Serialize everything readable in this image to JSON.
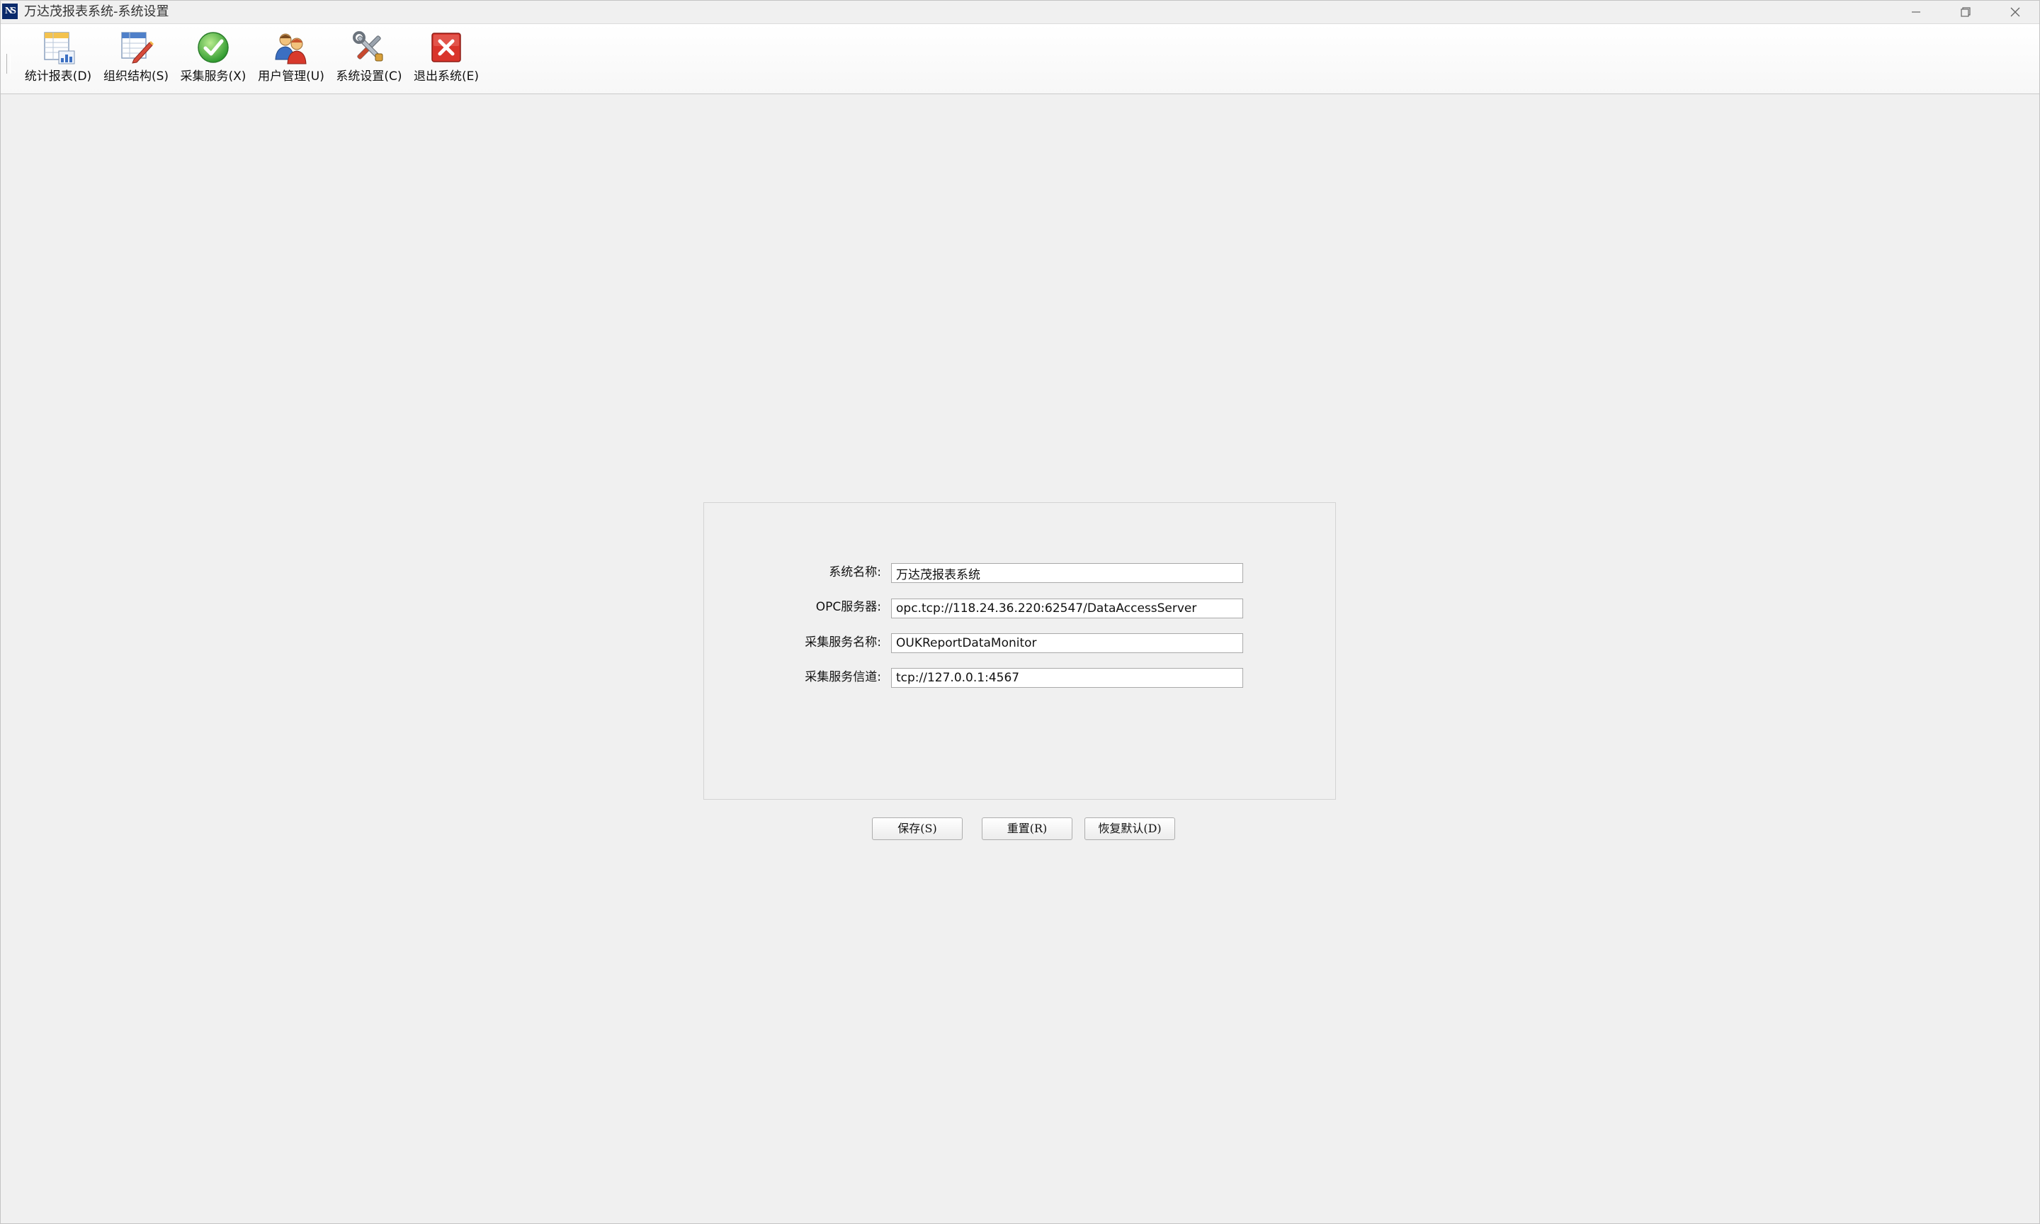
{
  "window": {
    "title": "万达茂报表系统-系统设置",
    "logo_text": "NS",
    "minimize_icon": "minimize-icon",
    "restore_icon": "restore-icon",
    "close_icon": "close-icon"
  },
  "toolbar": {
    "items": [
      {
        "label": "统计报表(D)",
        "icon": "report-chart-icon"
      },
      {
        "label": "组织结构(S)",
        "icon": "org-structure-edit-icon"
      },
      {
        "label": "采集服务(X)",
        "icon": "green-check-icon"
      },
      {
        "label": "用户管理(U)",
        "icon": "users-icon"
      },
      {
        "label": "系统设置(C)",
        "icon": "tools-icon"
      },
      {
        "label": "退出系统(E)",
        "icon": "red-exit-icon"
      }
    ]
  },
  "form": {
    "fields": [
      {
        "label": "系统名称:",
        "value": "万达茂报表系统"
      },
      {
        "label": "OPC服务器:",
        "value": "opc.tcp://118.24.36.220:62547/DataAccessServer"
      },
      {
        "label": "采集服务名称:",
        "value": "OUKReportDataMonitor"
      },
      {
        "label": "采集服务信道:",
        "value": "tcp://127.0.0.1:4567"
      }
    ]
  },
  "buttons": {
    "save": "保存(S)",
    "reset": "重置(R)",
    "restore_default": "恢复默认(D)"
  },
  "colors": {
    "background": "#f0f0f0",
    "accent_green": "#3aa83a",
    "accent_red": "#d9342b"
  }
}
